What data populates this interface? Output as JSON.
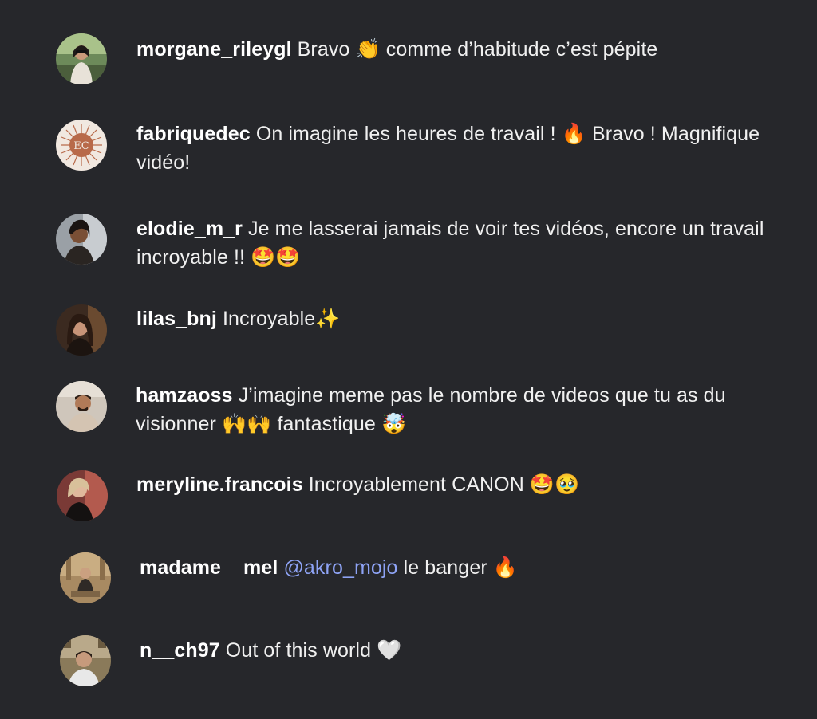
{
  "comments": [
    {
      "username": "morgane_rileygl",
      "text": "Bravo 👏 comme d’habitude c’est pépite"
    },
    {
      "username": "fabriquedec",
      "text": "On imagine les heures de travail ! 🔥 Bravo ! Magnifique vidéo!",
      "avatar_text": "EC"
    },
    {
      "username": "elodie_m_r",
      "text": "Je me lasserai jamais de voir tes vidéos, encore un travail incroyable !! 🤩🤩"
    },
    {
      "username": "lilas_bnj",
      "text": "Incroyable✨"
    },
    {
      "username": "hamzaoss",
      "text": "J’imagine meme pas le nombre de videos que tu as du visionner 🙌🙌 fantastique 🤯"
    },
    {
      "username": "meryline.francois",
      "text": "Incroyablement CANON 🤩🥹"
    },
    {
      "username": "madame__mel",
      "mention": "@akro_mojo",
      "text": "le banger 🔥"
    },
    {
      "username": "n__ch97",
      "text": "Out of this world 🤍"
    }
  ],
  "colors": {
    "background": "#26272b",
    "text": "#f0f0f0",
    "mention": "#8ea3f5"
  }
}
